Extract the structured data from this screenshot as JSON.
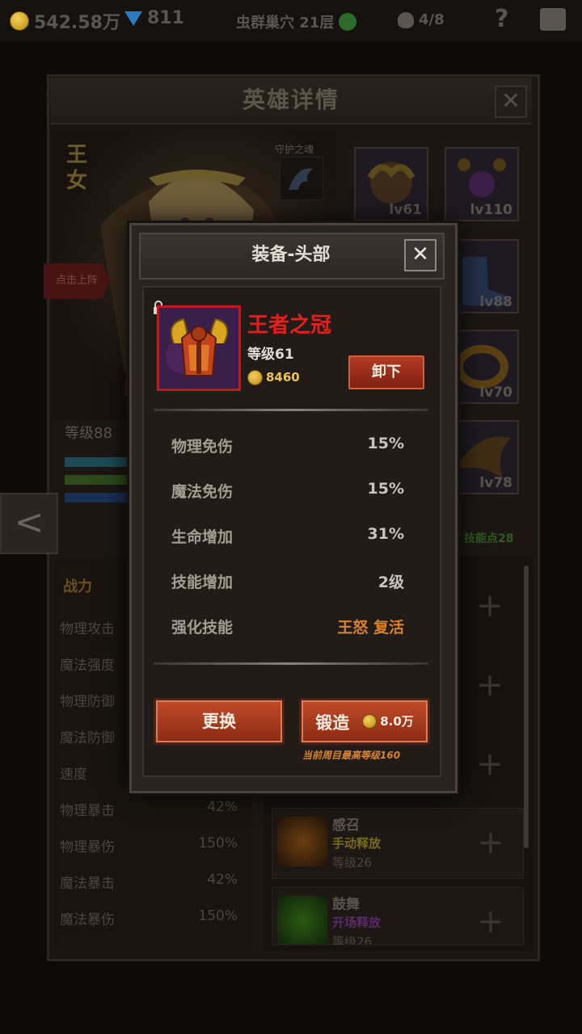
{
  "topbar": {
    "gold": "542.58万",
    "gems": "811",
    "stage": "虫群巢穴 21层",
    "kills": "4/8",
    "help": "?"
  },
  "hero_panel": {
    "title": "英雄详情",
    "close": "✕",
    "hero_name": "王女",
    "guardian_label": "守护之魂",
    "tap_to_deploy": "点击上阵",
    "level": "等级88",
    "equipment_levels": [
      "lv61",
      "lv110",
      "lv88",
      "lv70",
      "lv78"
    ],
    "back_arrow": "<",
    "skill_points": "技能点28",
    "stats_header": "战力",
    "stats": [
      {
        "label": "物理攻击",
        "value": ""
      },
      {
        "label": "魔法强度",
        "value": ""
      },
      {
        "label": "物理防御",
        "value": ""
      },
      {
        "label": "魔法防御",
        "value": ""
      },
      {
        "label": "速度",
        "value": ""
      },
      {
        "label": "物理暴击",
        "value": "42%"
      },
      {
        "label": "物理暴伤",
        "value": "150%"
      },
      {
        "label": "魔法暴击",
        "value": "42%"
      },
      {
        "label": "魔法暴伤",
        "value": "150%"
      }
    ],
    "plus": "+",
    "skills": [
      {
        "name": "感召",
        "type": "手动释放",
        "level": "等级26",
        "type_color": "#7a6a1e"
      },
      {
        "name": "鼓舞",
        "type": "开场释放",
        "level": "等级26",
        "type_color": "#5b2a6b"
      }
    ]
  },
  "modal": {
    "title": "装备-头部",
    "close": "✕",
    "item_name": "王者之冠",
    "item_level": "等级61",
    "item_cost": "8460",
    "unequip_label": "卸下",
    "attributes": [
      {
        "label": "物理免伤",
        "value": "15%"
      },
      {
        "label": "魔法免伤",
        "value": "15%"
      },
      {
        "label": "生命增加",
        "value": "31%"
      },
      {
        "label": "技能增加",
        "value": "2级"
      },
      {
        "label": "强化技能",
        "value": "王怒 复活"
      }
    ],
    "replace_label": "更换",
    "forge_label": "锻造",
    "forge_cost": "8.0万",
    "forge_note": "当前周目最高等级160"
  },
  "colors": {
    "accent_red": "#e3201c",
    "button_red": "#b33a25",
    "gold_text": "#f0c44a",
    "orange_text": "#d8822f"
  }
}
